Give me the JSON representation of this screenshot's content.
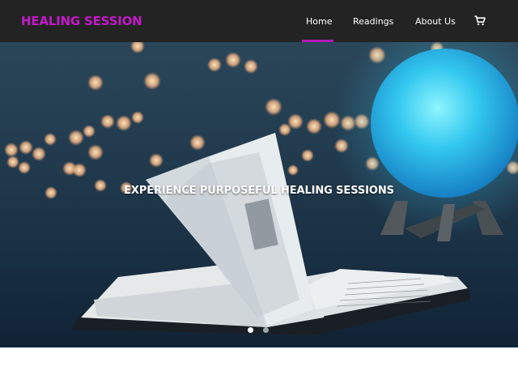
{
  "brand": "HEALING SESSION",
  "nav": {
    "items": [
      {
        "label": "Home",
        "active": true
      },
      {
        "label": "Readings",
        "active": false
      },
      {
        "label": "About Us",
        "active": false
      }
    ],
    "cart_icon": "shopping-cart-icon"
  },
  "colors": {
    "brand": "#c21ac8",
    "navbar_bg": "#232323",
    "active_indicator": "#b51ab6"
  },
  "hero": {
    "caption": "EXPERIENCE PURPOSEFUL HEALING SESSIONS",
    "image": "open book beside glowing blue moon lamp with bokeh lights",
    "slides_total": 2,
    "active_slide": 1
  }
}
